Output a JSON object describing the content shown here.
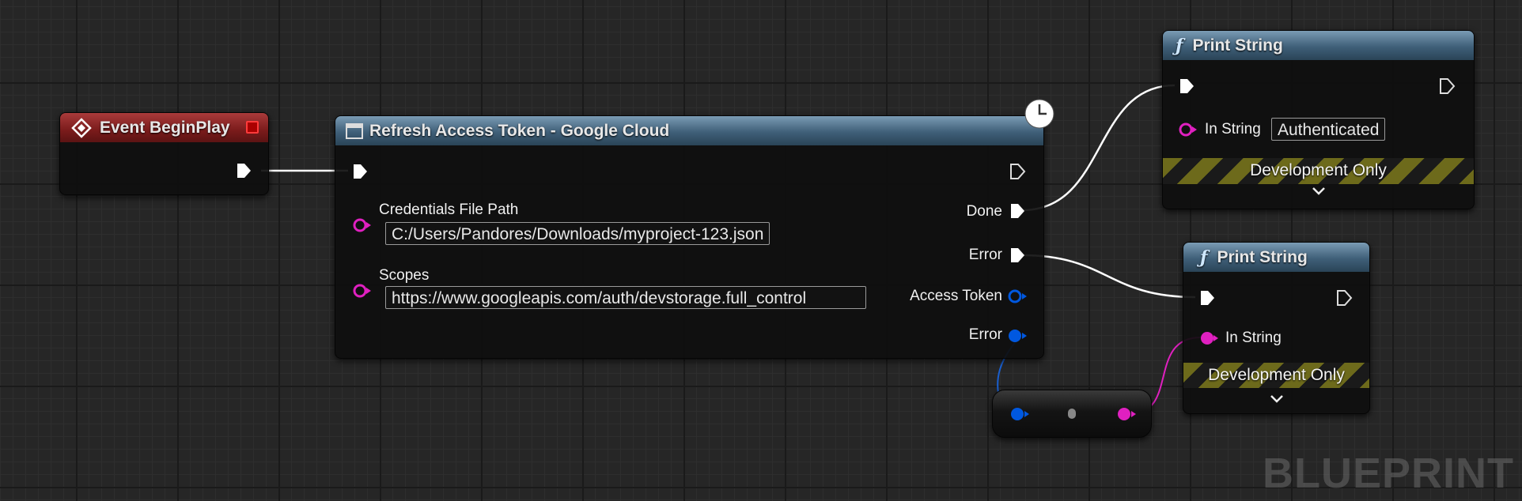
{
  "colors": {
    "exec_wire": "#ffffff",
    "string_pin": "#e020c0",
    "struct_pin": "#0050d0",
    "event_header": "#8a2222",
    "function_header": "#3f5f78"
  },
  "event_node": {
    "title": "Event BeginPlay",
    "icon": "event-diamond-icon"
  },
  "refresh_node": {
    "title": "Refresh Access Token - Google Cloud",
    "icon": "function-box-icon",
    "latent_icon": "clock-icon",
    "inputs": {
      "credentials_label": "Credentials File Path",
      "credentials_value": "C:/Users/Pandores/Downloads/myproject-123.json",
      "scopes_label": "Scopes",
      "scopes_value": "https://www.googleapis.com/auth/devstorage.full_control"
    },
    "outputs": {
      "done": "Done",
      "error_exec": "Error",
      "access_token": "Access Token",
      "error_struct": "Error"
    }
  },
  "print_string_1": {
    "title": "Print String",
    "icon": "function-f-icon",
    "in_string_label": "In String",
    "in_string_value": "Authenticated",
    "dev_label": "Development Only"
  },
  "print_string_2": {
    "title": "Print String",
    "icon": "function-f-icon",
    "in_string_label": "In String",
    "dev_label": "Development Only"
  },
  "watermark": "BLUEPRINT"
}
